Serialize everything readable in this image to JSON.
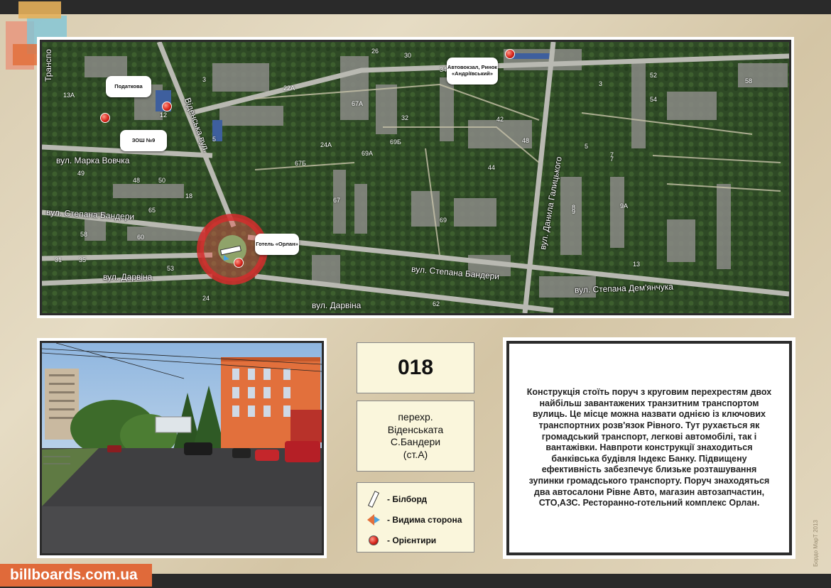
{
  "site": {
    "name": "billboards.com.ua",
    "credit": "Бордо МарТ 2013"
  },
  "map": {
    "streets": {
      "vidinska": "Віденська вул.",
      "marka_vovchka": "вул. Марка Вовчка",
      "bandery_left": "вул. Степана Бандери",
      "bandery_mid": "вул. Степана Бандери",
      "bandery_right": "вул. Степана Дем'янчука",
      "darvina_left": "вул. Дарвіна",
      "darvina_bottom": "вул. Дарвіна",
      "galytskoho": "вул. Данила Галицького",
      "transport": "Транспо"
    },
    "landmarks": {
      "podatkova": "Податкова",
      "zosh9": "ЗОШ №9",
      "hotel": "Готель «Орлан»",
      "autostation": "Автовокзал, Ринок «Андріївський»"
    },
    "numbers": [
      "13А",
      "3",
      "12",
      "5",
      "22А",
      "26",
      "30",
      "34",
      "67А",
      "32",
      "24А",
      "69А",
      "69Б",
      "42",
      "48",
      "44",
      "3",
      "5",
      "52",
      "54",
      "58",
      "7",
      "67Б",
      "49",
      "48",
      "50",
      "18",
      "65",
      "58",
      "60",
      "67",
      "69",
      "8",
      "9А",
      "13",
      "31",
      "35",
      "53",
      "24",
      "62",
      "9",
      "7"
    ]
  },
  "info": {
    "code": "018",
    "address": [
      "перехр.",
      "Віденськата",
      "С.Бандери",
      "(ст.А)"
    ],
    "description": "Конструкція стоїть поруч з круговим перехрестям двох найбільш завантажених транзитним транспортом вулиць. Це місце можна назвати однією із ключових транспортних розв'язок Рівного. Тут рухається як громадський транспорт, легкові автомобілі, так і вантажівки. Навпроти конструкції знаходиться банківська будівля Індекс Банку. Підвищену ефективність забезпечує близьке розташування зупинки громадського транспорту. Поруч знаходяться два автосалони Рівне Авто, магазин автозапчастин, СТО,АЗС. Ресторанно-готельний комплекс Орлан."
  },
  "legend": [
    {
      "icon": "billboard-icon",
      "label": "- Білборд"
    },
    {
      "icon": "visible-side-icon",
      "label": "- Видима сторона"
    },
    {
      "icon": "landmark-icon",
      "label": "- Орієнтири"
    }
  ],
  "colors": {
    "accent": "#e06a3a",
    "marker": "#d8261c",
    "circle": "#d42d2d"
  }
}
